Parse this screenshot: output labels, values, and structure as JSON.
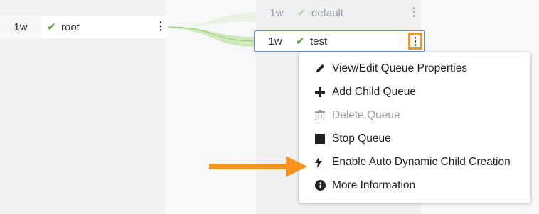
{
  "nodes": {
    "root": {
      "capacity": "1w",
      "name": "root",
      "status_icon": "check-icon"
    },
    "default": {
      "capacity": "1w",
      "name": "default",
      "status_icon": "check-icon"
    },
    "test": {
      "capacity": "1w",
      "name": "test",
      "status_icon": "check-icon"
    }
  },
  "menu": {
    "items": [
      {
        "label": "View/Edit Queue Properties",
        "icon": "pencil-icon",
        "enabled": true
      },
      {
        "label": "Add Child Queue",
        "icon": "plus-icon",
        "enabled": true
      },
      {
        "label": "Delete Queue",
        "icon": "trash-icon",
        "enabled": false
      },
      {
        "label": "Stop Queue",
        "icon": "stop-icon",
        "enabled": true
      },
      {
        "label": "Enable Auto Dynamic Child Creation",
        "icon": "bolt-icon",
        "enabled": true
      },
      {
        "label": "More Information",
        "icon": "info-icon",
        "enabled": true
      }
    ]
  },
  "colors": {
    "accent_orange": "#f7931e",
    "selected_border": "#5b93d6",
    "status_green": "#5a9e3a",
    "link_green": "#8fcf6d"
  }
}
